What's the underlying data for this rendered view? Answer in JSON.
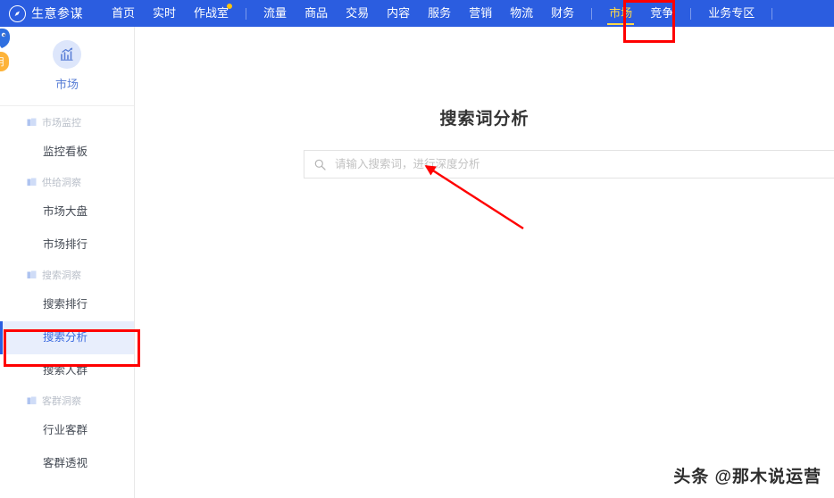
{
  "topnav": {
    "brand": "生意参谋",
    "brand_logo_icon": "compass-icon",
    "items": [
      {
        "label": "首页",
        "active": false,
        "dot": false
      },
      {
        "label": "实时",
        "active": false,
        "dot": false
      },
      {
        "label": "作战室",
        "active": false,
        "dot": true
      },
      {
        "label": "流量",
        "active": false,
        "dot": false
      },
      {
        "label": "商品",
        "active": false,
        "dot": false
      },
      {
        "label": "交易",
        "active": false,
        "dot": false
      },
      {
        "label": "内容",
        "active": false,
        "dot": false
      },
      {
        "label": "服务",
        "active": false,
        "dot": false
      },
      {
        "label": "营销",
        "active": false,
        "dot": false
      },
      {
        "label": "物流",
        "active": false,
        "dot": false
      },
      {
        "label": "财务",
        "active": false,
        "dot": false
      },
      {
        "label": "市场",
        "active": true,
        "dot": false
      },
      {
        "label": "竞争",
        "active": false,
        "dot": false
      },
      {
        "label": "业务专区",
        "active": false,
        "dot": false
      }
    ],
    "active_label": "市场",
    "active_color": "#ffd94a",
    "background_color": "#2b5de0"
  },
  "sidebar": {
    "header": {
      "label": "市场",
      "icon": "market-chart-icon"
    },
    "badge": "说明",
    "groups": [
      {
        "title": "市场监控",
        "icon": "folder-icon",
        "items": [
          {
            "label": "监控看板",
            "selected": false
          }
        ]
      },
      {
        "title": "供给洞察",
        "icon": "folder-icon",
        "items": [
          {
            "label": "市场大盘",
            "selected": false
          },
          {
            "label": "市场排行",
            "selected": false
          }
        ]
      },
      {
        "title": "搜索洞察",
        "icon": "folder-icon",
        "items": [
          {
            "label": "搜索排行",
            "selected": false
          },
          {
            "label": "搜索分析",
            "selected": true
          },
          {
            "label": "搜索人群",
            "selected": false
          }
        ]
      },
      {
        "title": "客群洞察",
        "icon": "folder-icon",
        "items": [
          {
            "label": "行业客群",
            "selected": false
          },
          {
            "label": "客群透视",
            "selected": false
          }
        ]
      }
    ],
    "selected_label": "搜索分析",
    "selected_color": "#3a6ae0"
  },
  "main": {
    "title": "搜索词分析",
    "search": {
      "placeholder": "请输入搜索词，进行深度分析",
      "value": "",
      "icon": "search-icon"
    }
  },
  "watermark": "头条 @那木说运营",
  "annotations": {
    "color": "#ff0000",
    "boxes": [
      "market-nav-tab",
      "search-analysis-menu-item"
    ],
    "arrow": "points-to-search-input"
  }
}
